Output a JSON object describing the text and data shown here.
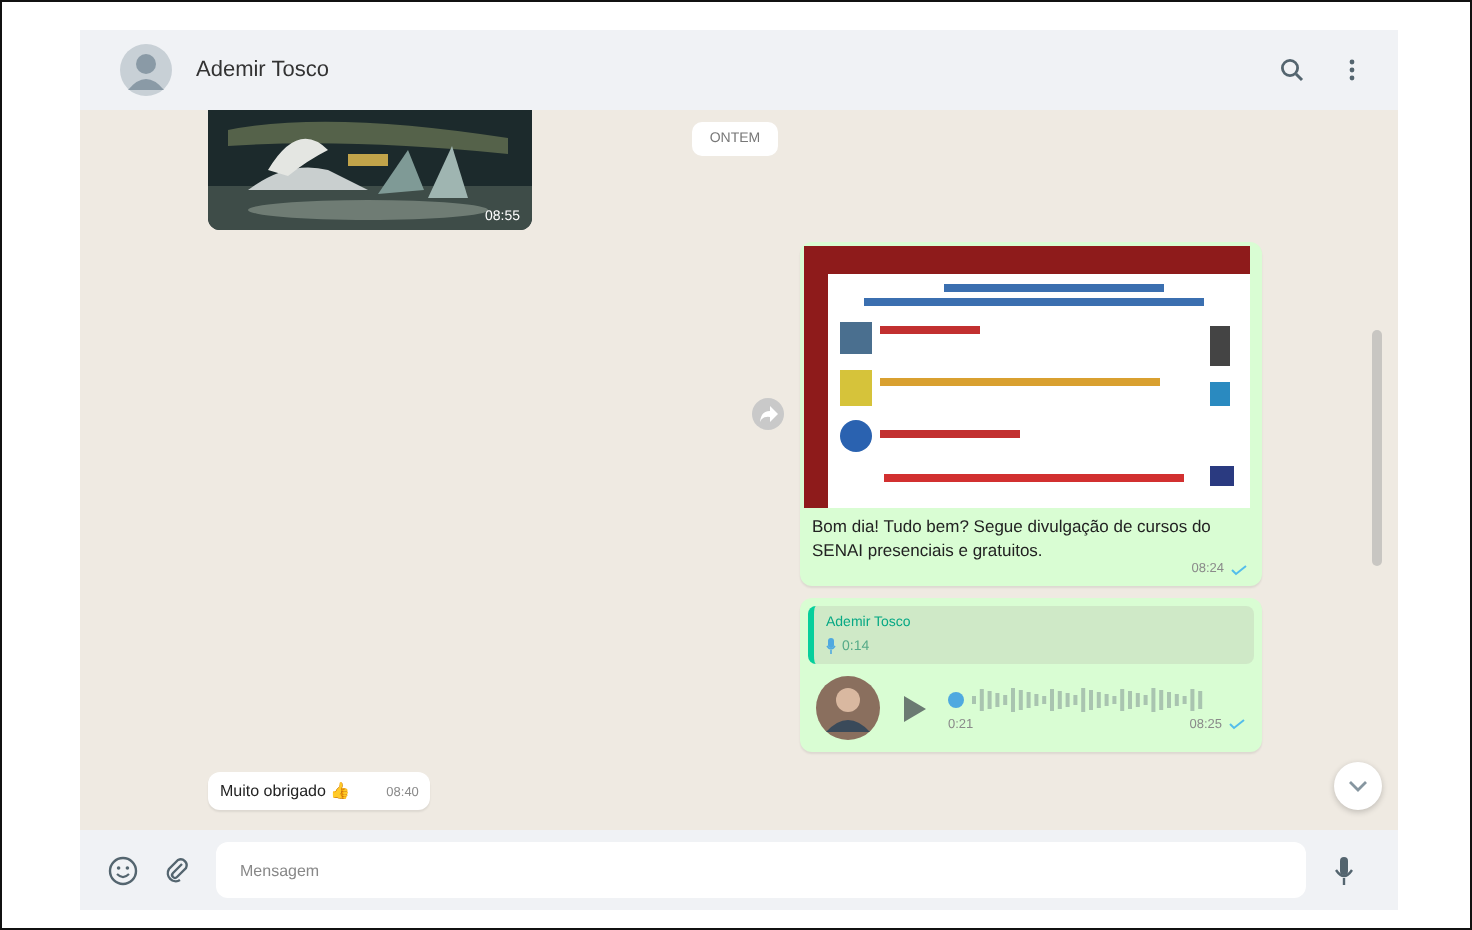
{
  "header": {
    "contact": "Ademir Tosco"
  },
  "date_chip": "ONTEM",
  "messages": [
    {
      "kind": "video",
      "duration": "08:55"
    },
    {
      "kind": "image_text",
      "text": "Bom dia! Tudo bem? Segue divulgação de cursos do SENAI presenciais e gratuitos.",
      "time": "08:24",
      "read": true
    },
    {
      "kind": "audio_reply",
      "quote_author": "Ademir Tosco",
      "quote_duration": "0:14",
      "duration": "0:21",
      "time": "08:25",
      "read": true
    },
    {
      "kind": "text",
      "text": "Muito obrigado 👍",
      "time": "08:40"
    }
  ],
  "composer": {
    "placeholder": "Mensagem"
  }
}
